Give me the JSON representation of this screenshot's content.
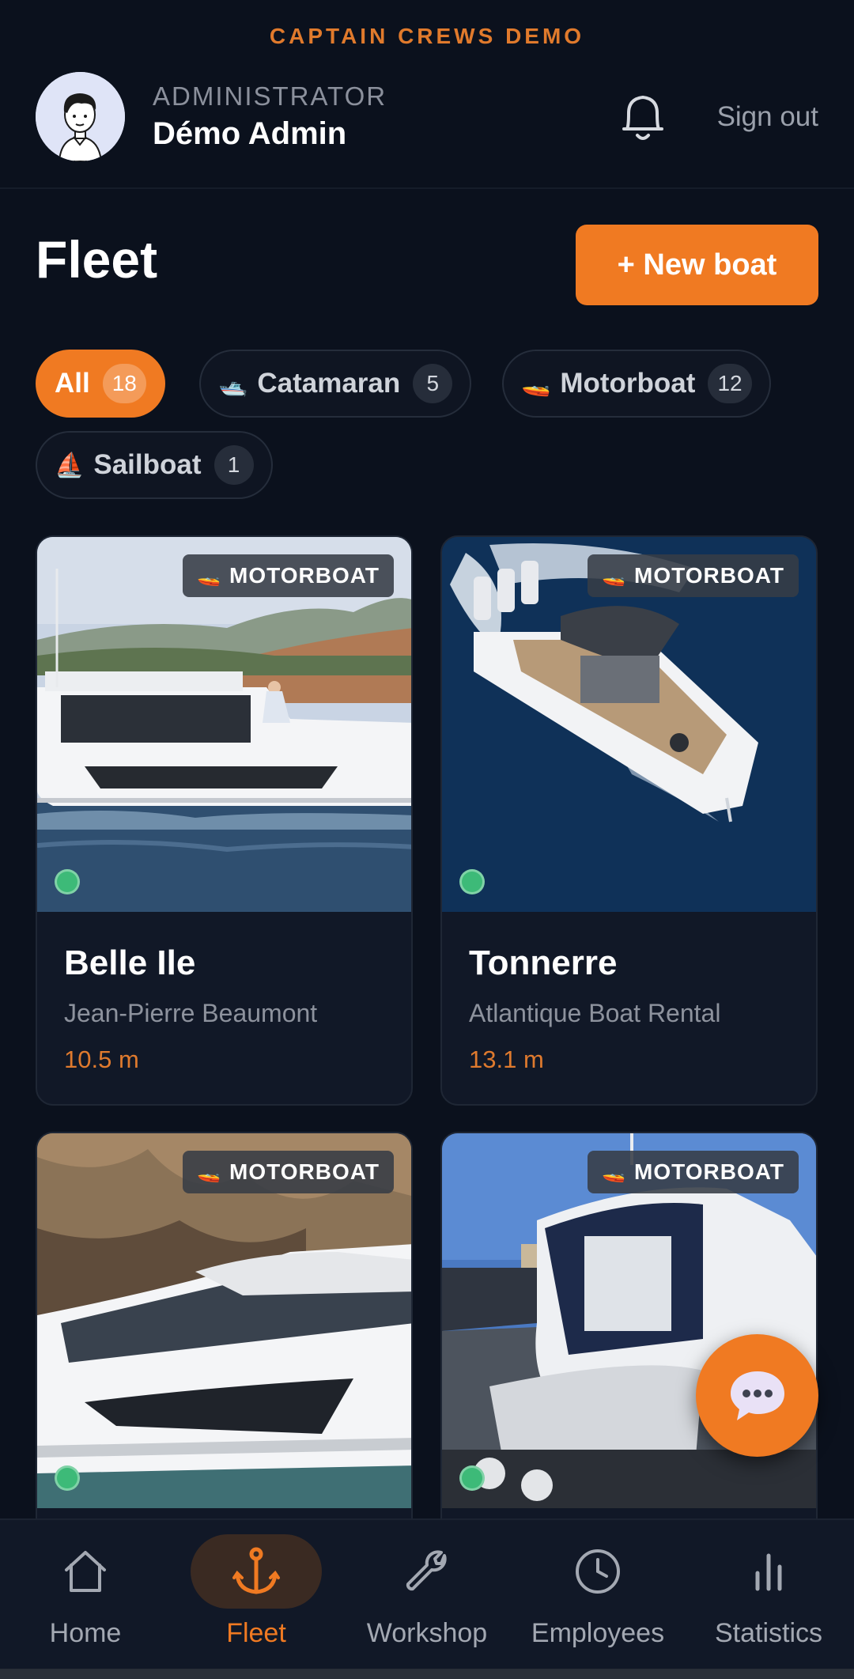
{
  "brand": "CAPTAIN CREWS DEMO",
  "user": {
    "role": "ADMINISTRATOR",
    "name": "Démo Admin"
  },
  "header": {
    "signout_label": "Sign out"
  },
  "page": {
    "title": "Fleet",
    "new_boat_label": "+ New boat"
  },
  "filters": [
    {
      "label": "All",
      "count": "18",
      "emoji": "",
      "active": true
    },
    {
      "label": "Catamaran",
      "count": "5",
      "emoji": "🛥️",
      "active": false
    },
    {
      "label": "Motorboat",
      "count": "12",
      "emoji": "🚤",
      "active": false
    },
    {
      "label": "Sailboat",
      "count": "1",
      "emoji": "⛵",
      "active": false
    }
  ],
  "boats": [
    {
      "name": "Belle Ile",
      "owner": "Jean-Pierre Beaumont",
      "length": "10.5 m",
      "type": "MOTORBOAT",
      "type_emoji": "🚤",
      "status": "active"
    },
    {
      "name": "Tonnerre",
      "owner": "Atlantique Boat Rental",
      "length": "13.1 m",
      "type": "MOTORBOAT",
      "type_emoji": "🚤",
      "status": "active"
    },
    {
      "name": "",
      "owner": "",
      "length": "",
      "type": "MOTORBOAT",
      "type_emoji": "🚤",
      "status": "active"
    },
    {
      "name": "",
      "owner": "",
      "length": "",
      "type": "MOTORBOAT",
      "type_emoji": "🚤",
      "status": "active"
    }
  ],
  "nav": [
    {
      "label": "Home",
      "icon": "home-icon",
      "active": false
    },
    {
      "label": "Fleet",
      "icon": "anchor-icon",
      "active": true
    },
    {
      "label": "Workshop",
      "icon": "wrench-icon",
      "active": false
    },
    {
      "label": "Employees",
      "icon": "clock-icon",
      "active": false
    },
    {
      "label": "Statistics",
      "icon": "bar-chart-icon",
      "active": false
    }
  ],
  "colors": {
    "accent": "#f07a22",
    "background": "#0b111d",
    "status_active": "#3dba78"
  }
}
